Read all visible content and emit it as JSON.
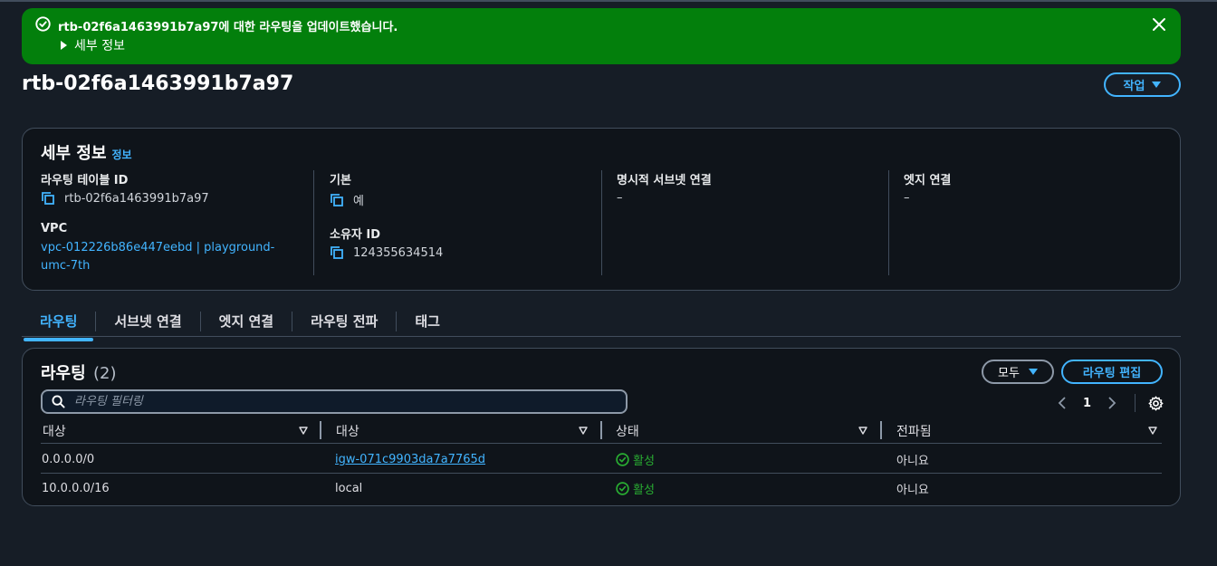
{
  "flash": {
    "message": "rtb-02f6a1463991b7a97에 대한 라우팅을 업데이트했습니다.",
    "details_label": "세부 정보",
    "color": "#037f0c"
  },
  "page": {
    "title": "rtb-02f6a1463991b7a97",
    "action_label": "작업"
  },
  "details": {
    "title": "세부 정보",
    "info_link": "정보",
    "fields": {
      "route_table_id_label": "라우팅 테이블 ID",
      "route_table_id_value": "rtb-02f6a1463991b7a97",
      "vpc_label": "VPC",
      "vpc_value_line1": "vpc-012226b86e447eebd | playground-",
      "vpc_value_line2": "umc-7th",
      "main_label": "기본",
      "main_value": "예",
      "owner_label": "소유자 ID",
      "owner_value": "124355634514",
      "explicit_subnet_label": "명시적 서브넷 연결",
      "explicit_subnet_value": "–",
      "edge_label": "엣지 연결",
      "edge_value": "–"
    }
  },
  "tabs": [
    {
      "label": "라우팅",
      "active": true
    },
    {
      "label": "서브넷 연결",
      "active": false
    },
    {
      "label": "엣지 연결",
      "active": false
    },
    {
      "label": "라우팅 전파",
      "active": false
    },
    {
      "label": "태그",
      "active": false
    }
  ],
  "routes": {
    "title": "라우팅",
    "count": "(2)",
    "filter_dropdown": "모두",
    "edit_button": "라우팅 편집",
    "search_placeholder": "라우팅 필터링",
    "page_number": "1",
    "columns": [
      "대상",
      "대상",
      "상태",
      "전파됨"
    ],
    "rows": [
      {
        "destination": "0.0.0.0/0",
        "target": "igw-071c9903da7a7765d",
        "target_is_link": true,
        "status": "활성",
        "propagated": "아니요"
      },
      {
        "destination": "10.0.0.0/16",
        "target": "local",
        "target_is_link": false,
        "status": "활성",
        "propagated": "아니요"
      }
    ]
  },
  "colors": {
    "accent": "#42b4ff",
    "success": "#29ad32",
    "background": "#161d26"
  }
}
